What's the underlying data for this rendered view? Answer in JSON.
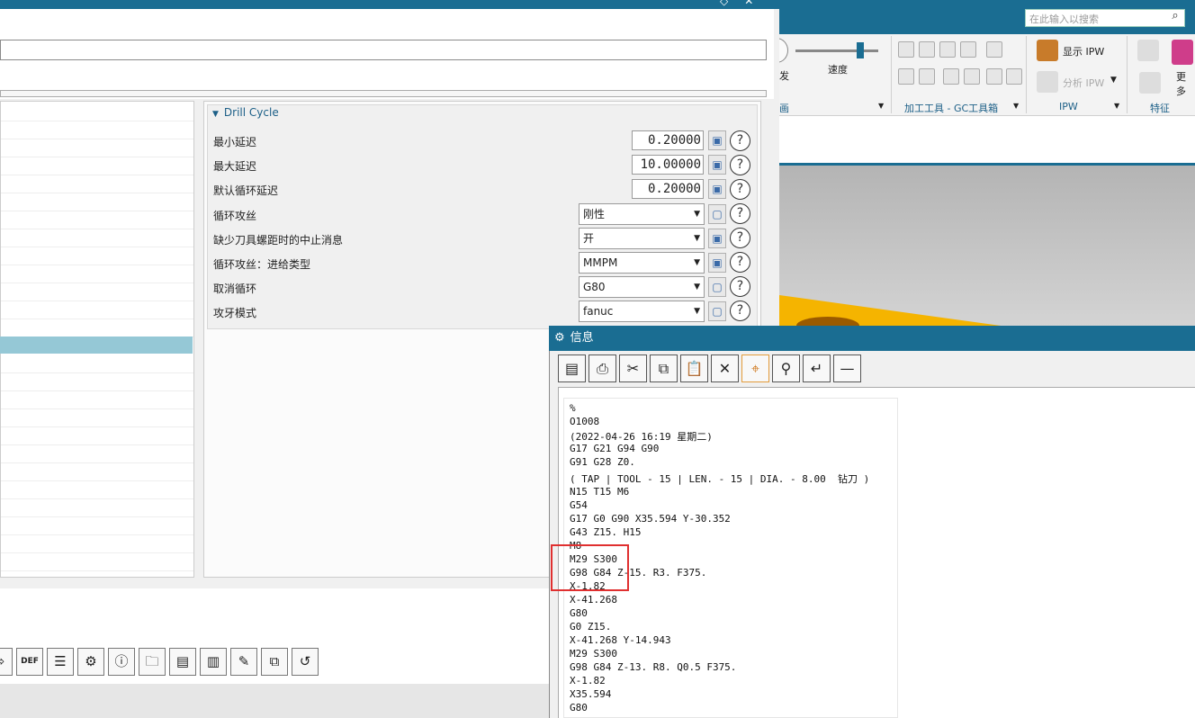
{
  "ribbon": {
    "search_placeholder": "在此输入以搜索",
    "speed_label": "速度",
    "show_ipw": "显示 IPW",
    "analyze_ipw": "分析 IPW",
    "more_label": "更多",
    "group_view_suffix": "画",
    "group_tools": "加工工具 - GC工具箱",
    "group_ipw": "IPW",
    "group_feature": "特征",
    "knob_fragment": "发"
  },
  "dialog": {
    "section_title": "Drill Cycle",
    "params": [
      {
        "label": "最小延迟",
        "kind": "number",
        "value": "0.20000",
        "lock": "locked"
      },
      {
        "label": "最大延迟",
        "kind": "number",
        "value": "10.00000",
        "lock": "locked"
      },
      {
        "label": "默认循环延迟",
        "kind": "number",
        "value": "0.20000",
        "lock": "locked"
      },
      {
        "label": "循环攻丝",
        "kind": "select",
        "value": "刚性",
        "lock": "unlocked"
      },
      {
        "label": "缺少刀具螺距时的中止消息",
        "kind": "select",
        "value": "开",
        "lock": "locked"
      },
      {
        "label": "循环攻丝：进给类型",
        "kind": "select",
        "value": "MMPM",
        "lock": "locked"
      },
      {
        "label": "取消循环",
        "kind": "select",
        "value": "G80",
        "lock": "unlocked"
      },
      {
        "label": "攻牙模式",
        "kind": "select",
        "value": "fanuc",
        "lock": "unlocked"
      }
    ],
    "help_glyph": "?",
    "bottom_toolbar": [
      "import-icon",
      "def-icon",
      "edit-list-icon",
      "settings-icon",
      "info-icon",
      "open-folder-icon",
      "save-as-icon",
      "save-icon",
      "edit-file-icon",
      "copy-file-icon",
      "undo-icon"
    ],
    "def_glyph": "DEF",
    "info_glyph": "ⓘ"
  },
  "info": {
    "title": "信息",
    "toolbar": [
      "save-icon",
      "print-icon",
      "cut-icon",
      "copy-icon",
      "paste-icon",
      "clear-icon",
      "target-icon",
      "find-icon",
      "wrap-icon",
      "minimize-icon"
    ],
    "lines": [
      "%",
      "O1008",
      "(2022-04-26 16:19 星期二)",
      "G17 G21 G94 G90",
      "G91 G28 Z0.",
      "( TAP | TOOL - 15 | LEN. - 15 | DIA. - 8.00  钻刀 )",
      "N15 T15 M6",
      "G54",
      "G17 G0 G90 X35.594 Y-30.352",
      "G43 Z15. H15",
      "M8",
      "M29 S300",
      "G98 G84 Z-15. R3. F375.",
      "X-1.82",
      "X-41.268",
      "G80",
      "G0 Z15.",
      "X-41.268 Y-14.943",
      "M29 S300",
      "G98 G84 Z-13. R8. Q0.5 F375.",
      "X-1.82",
      "X35.594",
      "G80"
    ]
  }
}
